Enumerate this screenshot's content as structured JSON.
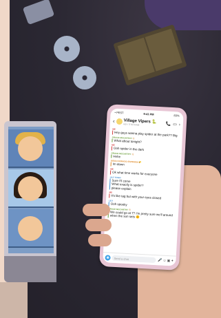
{
  "status_bar": {
    "carrier": "• PEST",
    "time": "9:41 PM",
    "battery": "83%"
  },
  "chat": {
    "title": "Village Vipers",
    "emoji": "🐍",
    "subtitle": "KEY, TITO KANE"
  },
  "messages": [
    {
      "sender": "ME",
      "sender_color": "#d23b3b",
      "text": "Hey guys wanna play spider at the park?? Big"
    },
    {
      "sender": "GRACE MCCARTHY 👋🏻",
      "sender_color": "#6a9e3a",
      "text": "What about tonight?"
    },
    {
      "sender": "ME",
      "sender_color": "#d23b3b",
      "text": "Ooh spider in the dark"
    },
    {
      "sender": "GRACE MCCARTHY 👋🏻",
      "sender_color": "#6a9e3a",
      "text": "Hehe"
    },
    {
      "sender": "DIEGO DORADO-ESPINOSA 🌮",
      "sender_color": "#e08a2a",
      "text": "Im down"
    },
    {
      "sender": "ME",
      "sender_color": "#d23b3b",
      "text": "Ok what time works for everyone"
    },
    {
      "sender": "LILY TOGO",
      "sender_color": "#3a8ad0",
      "text": "Sure I'll come\nWhat exactly is spider?\nplease explain"
    },
    {
      "sender": "ME",
      "sender_color": "#d23b3b",
      "text": "It's like tag but with your eyes closed"
    },
    {
      "sender": "LILY",
      "sender_color": "#3a8ad0",
      "text": "Ooh spooky"
    },
    {
      "sender": "GRACE MCCARTHY 👋🏻",
      "sender_color": "#6a9e3a",
      "text": "We could go at 7? I'm pretty sure we'll around when the sun sets 🌞"
    }
  ],
  "input": {
    "placeholder": "Send a chat"
  },
  "icons": {
    "back": "‹",
    "call": "📞",
    "video": "▭",
    "more": "›",
    "camera": "◉",
    "mic": "🎤",
    "emoji": "☺",
    "sticker": "▣",
    "rocket": "✦"
  },
  "colors": {
    "phone_case": "#e8c6d5",
    "accent_blue": "#3aa0e8"
  }
}
